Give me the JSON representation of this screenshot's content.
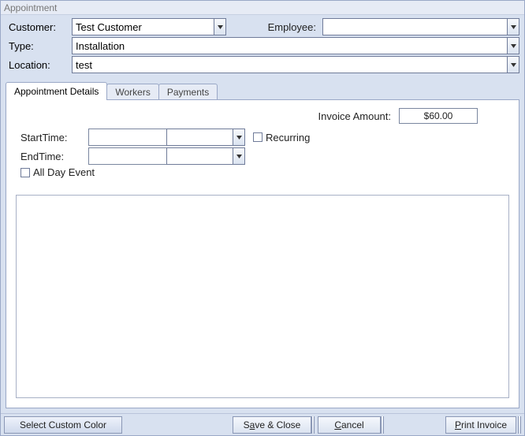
{
  "window": {
    "title": "Appointment"
  },
  "header": {
    "customer_label": "Customer:",
    "customer_value": "Test Customer",
    "employee_label": "Employee:",
    "employee_value": "",
    "type_label": "Type:",
    "type_value": "Installation",
    "location_label": "Location:",
    "location_value": "test"
  },
  "tabs": {
    "details": "Appointment Details",
    "workers": "Workers",
    "payments": "Payments"
  },
  "details": {
    "invoice_label": "Invoice Amount:",
    "invoice_value": "$60.00",
    "starttime_label": "StartTime:",
    "starttime_date": "",
    "starttime_time": "",
    "endtime_label": "EndTime:",
    "endtime_date": "",
    "endtime_time": "",
    "recurring_label": "Recurring",
    "allday_label": "All Day Event",
    "recurring_checked": false,
    "allday_checked": false
  },
  "footer": {
    "color": "Select Custom Color",
    "save_prefix": "S",
    "save_u": "a",
    "save_suffix": "ve & Close",
    "cancel_u": "C",
    "cancel_suffix": "ancel",
    "print_u": "P",
    "print_suffix": "rint Invoice"
  }
}
